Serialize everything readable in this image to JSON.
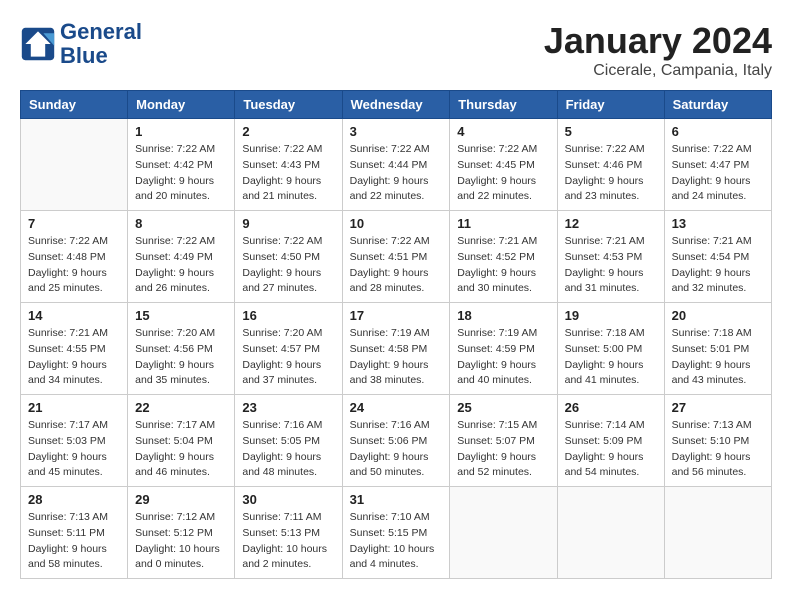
{
  "header": {
    "logo_line1": "General",
    "logo_line2": "Blue",
    "month_title": "January 2024",
    "location": "Cicerale, Campania, Italy"
  },
  "days_of_week": [
    "Sunday",
    "Monday",
    "Tuesday",
    "Wednesday",
    "Thursday",
    "Friday",
    "Saturday"
  ],
  "weeks": [
    [
      {
        "day": "",
        "info": ""
      },
      {
        "day": "1",
        "info": "Sunrise: 7:22 AM\nSunset: 4:42 PM\nDaylight: 9 hours\nand 20 minutes."
      },
      {
        "day": "2",
        "info": "Sunrise: 7:22 AM\nSunset: 4:43 PM\nDaylight: 9 hours\nand 21 minutes."
      },
      {
        "day": "3",
        "info": "Sunrise: 7:22 AM\nSunset: 4:44 PM\nDaylight: 9 hours\nand 22 minutes."
      },
      {
        "day": "4",
        "info": "Sunrise: 7:22 AM\nSunset: 4:45 PM\nDaylight: 9 hours\nand 22 minutes."
      },
      {
        "day": "5",
        "info": "Sunrise: 7:22 AM\nSunset: 4:46 PM\nDaylight: 9 hours\nand 23 minutes."
      },
      {
        "day": "6",
        "info": "Sunrise: 7:22 AM\nSunset: 4:47 PM\nDaylight: 9 hours\nand 24 minutes."
      }
    ],
    [
      {
        "day": "7",
        "info": "Sunrise: 7:22 AM\nSunset: 4:48 PM\nDaylight: 9 hours\nand 25 minutes."
      },
      {
        "day": "8",
        "info": "Sunrise: 7:22 AM\nSunset: 4:49 PM\nDaylight: 9 hours\nand 26 minutes."
      },
      {
        "day": "9",
        "info": "Sunrise: 7:22 AM\nSunset: 4:50 PM\nDaylight: 9 hours\nand 27 minutes."
      },
      {
        "day": "10",
        "info": "Sunrise: 7:22 AM\nSunset: 4:51 PM\nDaylight: 9 hours\nand 28 minutes."
      },
      {
        "day": "11",
        "info": "Sunrise: 7:21 AM\nSunset: 4:52 PM\nDaylight: 9 hours\nand 30 minutes."
      },
      {
        "day": "12",
        "info": "Sunrise: 7:21 AM\nSunset: 4:53 PM\nDaylight: 9 hours\nand 31 minutes."
      },
      {
        "day": "13",
        "info": "Sunrise: 7:21 AM\nSunset: 4:54 PM\nDaylight: 9 hours\nand 32 minutes."
      }
    ],
    [
      {
        "day": "14",
        "info": "Sunrise: 7:21 AM\nSunset: 4:55 PM\nDaylight: 9 hours\nand 34 minutes."
      },
      {
        "day": "15",
        "info": "Sunrise: 7:20 AM\nSunset: 4:56 PM\nDaylight: 9 hours\nand 35 minutes."
      },
      {
        "day": "16",
        "info": "Sunrise: 7:20 AM\nSunset: 4:57 PM\nDaylight: 9 hours\nand 37 minutes."
      },
      {
        "day": "17",
        "info": "Sunrise: 7:19 AM\nSunset: 4:58 PM\nDaylight: 9 hours\nand 38 minutes."
      },
      {
        "day": "18",
        "info": "Sunrise: 7:19 AM\nSunset: 4:59 PM\nDaylight: 9 hours\nand 40 minutes."
      },
      {
        "day": "19",
        "info": "Sunrise: 7:18 AM\nSunset: 5:00 PM\nDaylight: 9 hours\nand 41 minutes."
      },
      {
        "day": "20",
        "info": "Sunrise: 7:18 AM\nSunset: 5:01 PM\nDaylight: 9 hours\nand 43 minutes."
      }
    ],
    [
      {
        "day": "21",
        "info": "Sunrise: 7:17 AM\nSunset: 5:03 PM\nDaylight: 9 hours\nand 45 minutes."
      },
      {
        "day": "22",
        "info": "Sunrise: 7:17 AM\nSunset: 5:04 PM\nDaylight: 9 hours\nand 46 minutes."
      },
      {
        "day": "23",
        "info": "Sunrise: 7:16 AM\nSunset: 5:05 PM\nDaylight: 9 hours\nand 48 minutes."
      },
      {
        "day": "24",
        "info": "Sunrise: 7:16 AM\nSunset: 5:06 PM\nDaylight: 9 hours\nand 50 minutes."
      },
      {
        "day": "25",
        "info": "Sunrise: 7:15 AM\nSunset: 5:07 PM\nDaylight: 9 hours\nand 52 minutes."
      },
      {
        "day": "26",
        "info": "Sunrise: 7:14 AM\nSunset: 5:09 PM\nDaylight: 9 hours\nand 54 minutes."
      },
      {
        "day": "27",
        "info": "Sunrise: 7:13 AM\nSunset: 5:10 PM\nDaylight: 9 hours\nand 56 minutes."
      }
    ],
    [
      {
        "day": "28",
        "info": "Sunrise: 7:13 AM\nSunset: 5:11 PM\nDaylight: 9 hours\nand 58 minutes."
      },
      {
        "day": "29",
        "info": "Sunrise: 7:12 AM\nSunset: 5:12 PM\nDaylight: 10 hours\nand 0 minutes."
      },
      {
        "day": "30",
        "info": "Sunrise: 7:11 AM\nSunset: 5:13 PM\nDaylight: 10 hours\nand 2 minutes."
      },
      {
        "day": "31",
        "info": "Sunrise: 7:10 AM\nSunset: 5:15 PM\nDaylight: 10 hours\nand 4 minutes."
      },
      {
        "day": "",
        "info": ""
      },
      {
        "day": "",
        "info": ""
      },
      {
        "day": "",
        "info": ""
      }
    ]
  ]
}
